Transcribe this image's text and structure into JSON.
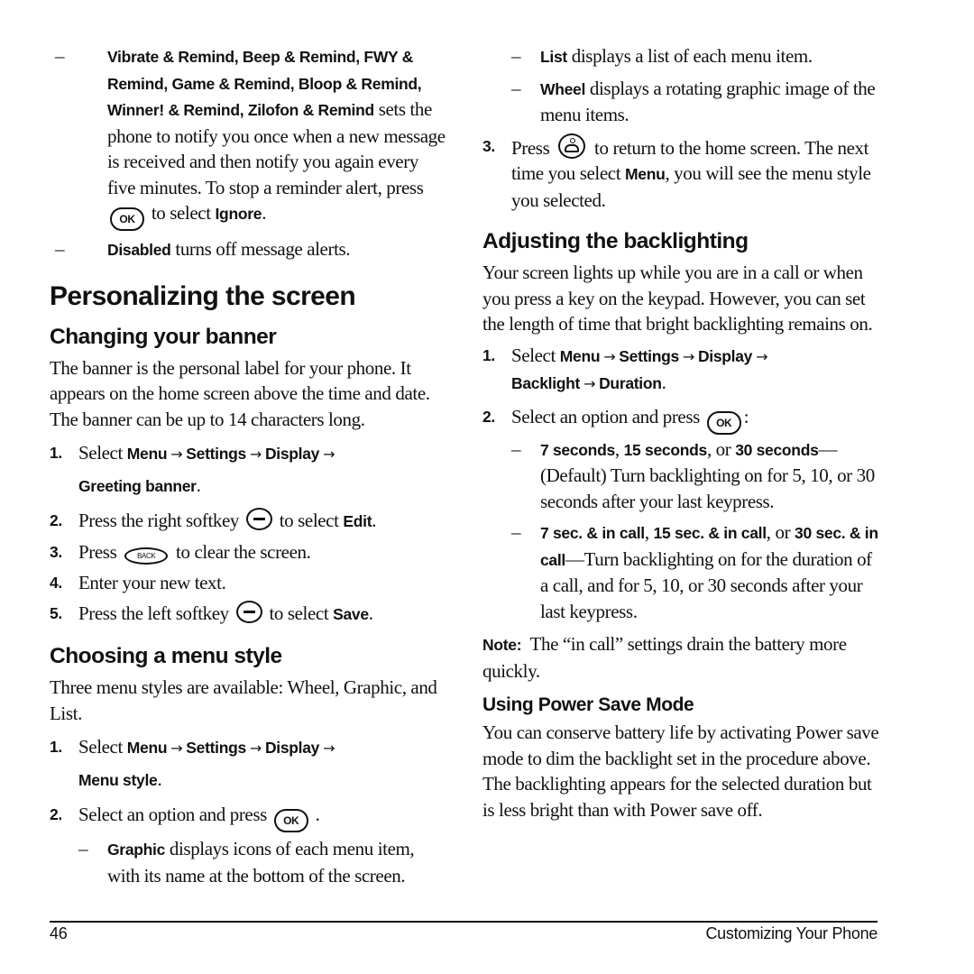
{
  "left": {
    "alert_items": [
      {
        "dash": "–",
        "bold": "Vibrate & Remind",
        "sep1": ", ",
        "bold2": "Beep & Remind, FWY & Remind, Game & Remind, Bloop & Remind, Winner! & Remind, Zilofon & Remind",
        "text": " sets the phone to notify you once when a new message is received and then notify you again every five minutes. To stop a reminder alert, press ",
        "key": "OK",
        "text2": " to select ",
        "bold3": "Ignore",
        "end": "."
      },
      {
        "dash": "–",
        "bold": "Disabled",
        "text": " turns off message alerts."
      }
    ],
    "section_title": "Personalizing the screen",
    "banner": {
      "heading": "Changing your banner",
      "intro": "The banner is the personal label for your phone. It appears on the home screen above the time and date. The banner can be up to 14 characters long.",
      "steps": [
        {
          "num": "1.",
          "pre": "Select ",
          "path": [
            "Menu",
            "Settings",
            "Display",
            "Greeting banner"
          ],
          "end": "."
        },
        {
          "num": "2.",
          "pre": "Press the right softkey ",
          "key": "softkey",
          "mid": " to select ",
          "bold": "Edit",
          "end": "."
        },
        {
          "num": "3.",
          "pre": "Press ",
          "key": "BACK",
          "mid": " to clear the screen."
        },
        {
          "num": "4.",
          "pre": "Enter your new text."
        },
        {
          "num": "5.",
          "pre": "Press the left softkey ",
          "key": "softkey",
          "mid": " to select ",
          "bold": "Save",
          "end": "."
        }
      ]
    },
    "menu_style": {
      "heading": "Choosing a menu style",
      "intro": "Three menu styles are available: Wheel, Graphic, and List.",
      "steps": [
        {
          "num": "1.",
          "pre": "Select ",
          "path": [
            "Menu",
            "Settings",
            "Display",
            "Menu style"
          ],
          "end": "."
        },
        {
          "num": "2.",
          "pre": "Select an option and press ",
          "key": "OK",
          "end": " ."
        }
      ],
      "options": [
        {
          "dash": "–",
          "bold": "Graphic",
          "text": " displays icons of each menu item, with its name at the bottom of the screen."
        }
      ]
    }
  },
  "right": {
    "menu_options": [
      {
        "dash": "–",
        "bold": "List",
        "text": " displays a list of each menu item."
      },
      {
        "dash": "–",
        "bold": "Wheel",
        "text": " displays a rotating graphic image of the menu items."
      }
    ],
    "step3": {
      "num": "3.",
      "pre": "Press ",
      "key": "end-key",
      "text": " to return to the home screen. The next time you select ",
      "bold": "Menu",
      "text2": ", you will see the menu style you selected."
    },
    "backlight": {
      "heading": "Adjusting the backlighting",
      "intro": "Your screen lights up while you are in a call or when you press a key on the keypad. However, you can set the length of time that bright backlighting remains on.",
      "steps": [
        {
          "num": "1.",
          "pre": "Select ",
          "path": [
            "Menu",
            "Settings",
            "Display",
            "Backlight",
            "Duration"
          ],
          "end": "."
        },
        {
          "num": "2.",
          "pre": "Select an option and press ",
          "key": "OK",
          "end": ":"
        }
      ],
      "options": [
        {
          "dash": "–",
          "b1": "7 seconds",
          "s1": ", ",
          "b2": "15 seconds",
          "s2": ", or ",
          "b3": "30 seconds",
          "text": "—(Default) Turn backlighting on for 5, 10, or 30 seconds after your last keypress."
        },
        {
          "dash": "–",
          "b1": "7 sec. & in call",
          "s1": ", ",
          "b2": "15 sec. & in call",
          "s2": ", or ",
          "b3": "30 sec. & in call",
          "text": "—Turn backlighting on for the duration of a call, and for 5, 10, or 30 seconds after your last keypress."
        }
      ],
      "note_label": "Note:",
      "note_text": "  The “in call” settings drain the battery more quickly."
    },
    "power_save": {
      "heading": "Using Power Save Mode",
      "text": "You can conserve battery life by activating Power save mode to dim the backlight set in the procedure above. The backlighting appears for the selected duration but is less bright than with Power save off."
    }
  },
  "footer": {
    "page_number": "46",
    "chapter_title": "Customizing Your Phone"
  },
  "icons": {
    "arrow": "→"
  }
}
